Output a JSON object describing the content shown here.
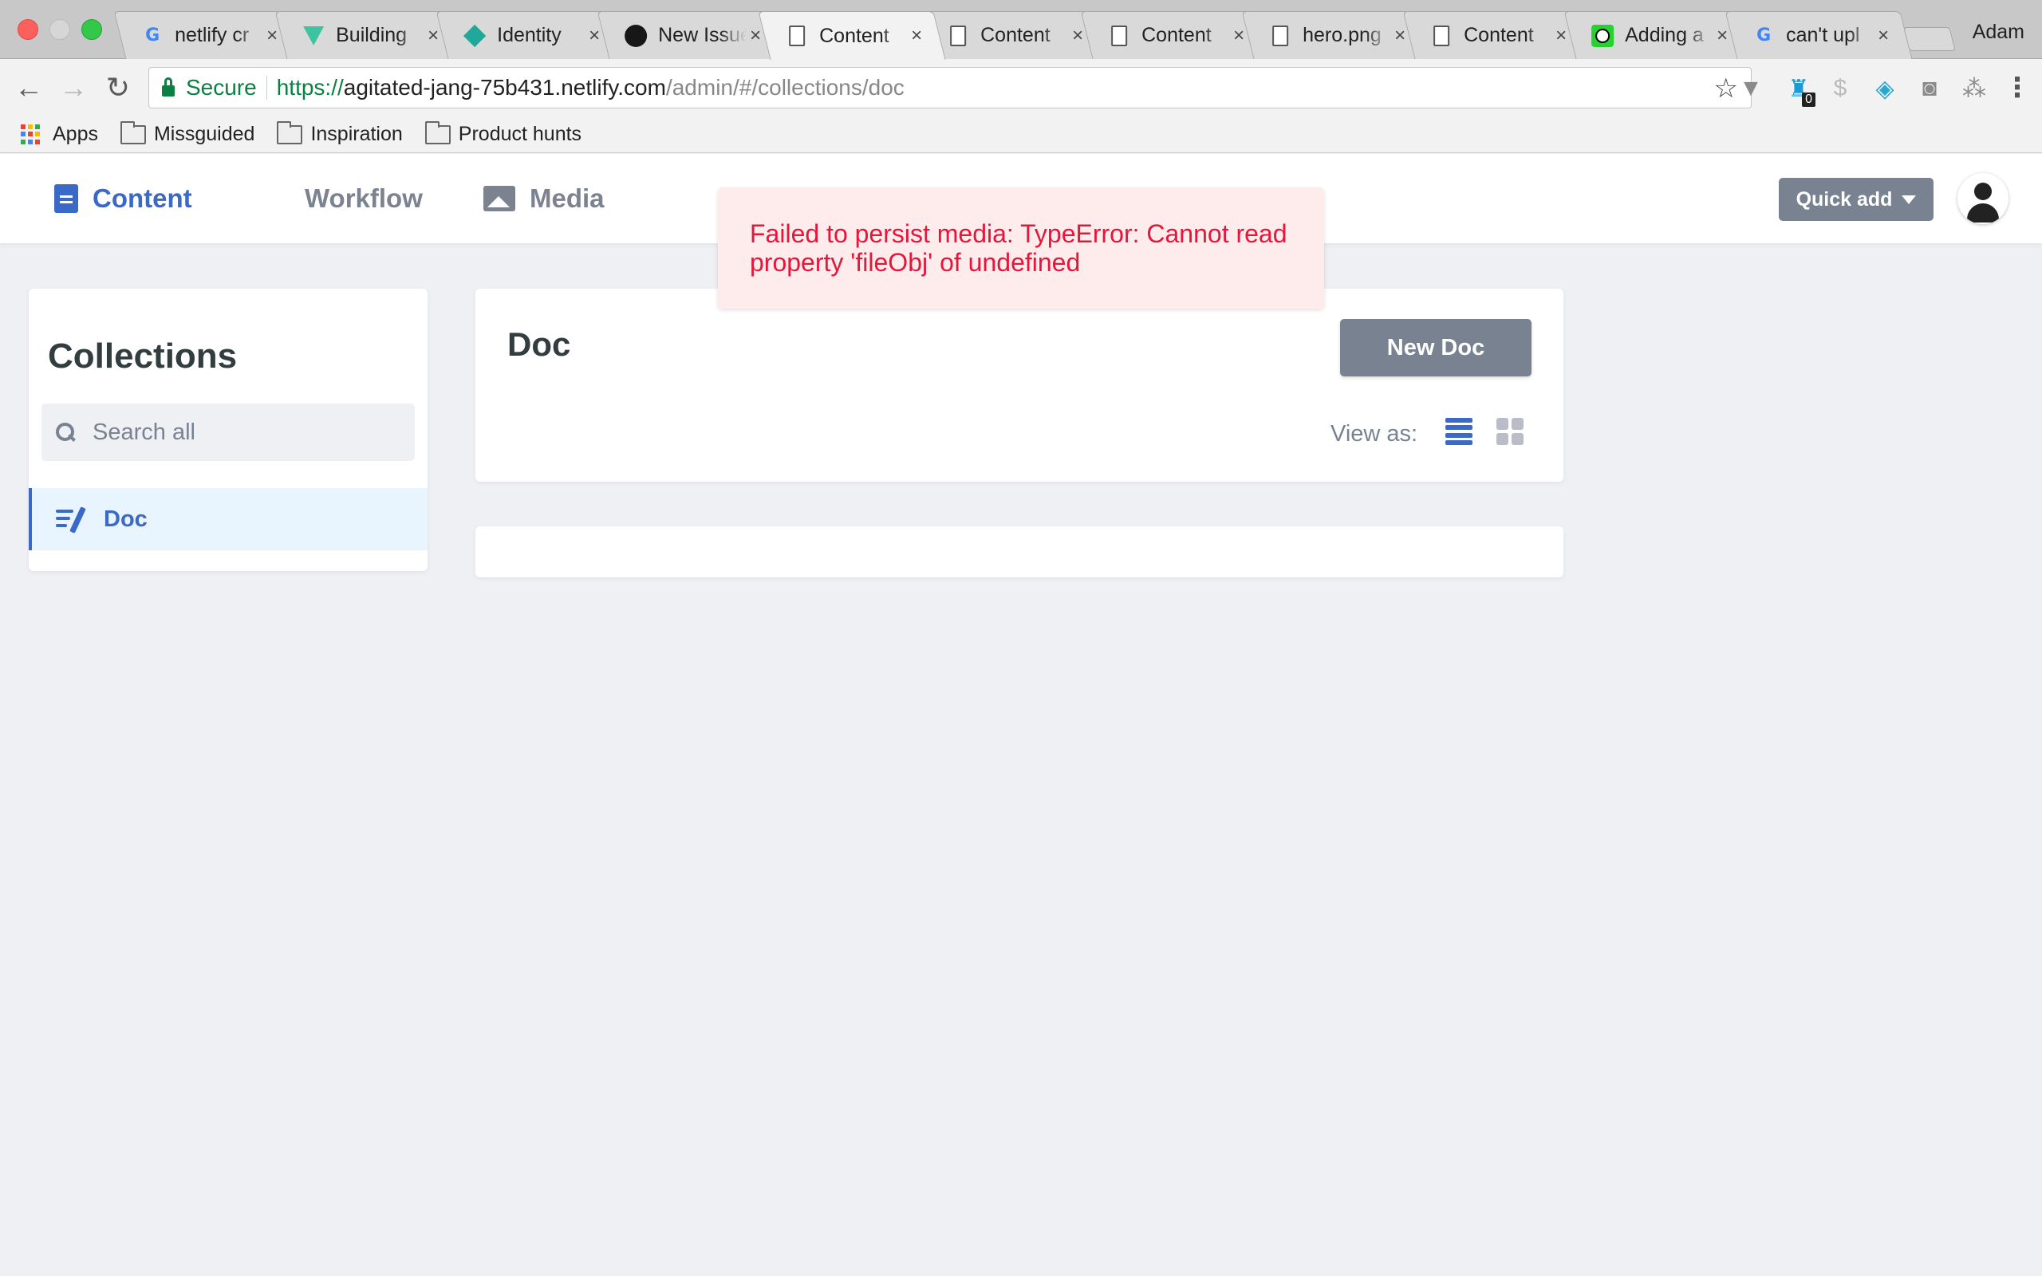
{
  "browser": {
    "tabs": [
      {
        "title": "netlify cr",
        "favicon": "google-icon",
        "active": false
      },
      {
        "title": "Building",
        "favicon": "vue-icon",
        "active": false
      },
      {
        "title": "Identity",
        "favicon": "netlify-icon",
        "active": false
      },
      {
        "title": "New Issue",
        "favicon": "github-icon",
        "active": false
      },
      {
        "title": "Content",
        "favicon": "page-icon",
        "active": true
      },
      {
        "title": "Content",
        "favicon": "page-icon",
        "active": false
      },
      {
        "title": "Content",
        "favicon": "page-icon",
        "active": false
      },
      {
        "title": "hero.png",
        "favicon": "page-icon",
        "active": false
      },
      {
        "title": "Content",
        "favicon": "page-icon",
        "active": false
      },
      {
        "title": "Adding a",
        "favicon": "clock-icon",
        "active": false
      },
      {
        "title": "can't upl",
        "favicon": "google-icon",
        "active": false
      }
    ],
    "profile_name": "Adam",
    "secure_label": "Secure",
    "url": {
      "scheme": "https://",
      "host": "agitated-jang-75b431.netlify.com",
      "path": "/admin/#/collections/doc"
    },
    "extension_badge": "0",
    "bookmarks": [
      {
        "label": "Apps",
        "icon": "apps-icon"
      },
      {
        "label": "Missguided",
        "icon": "folder-icon"
      },
      {
        "label": "Inspiration",
        "icon": "folder-icon"
      },
      {
        "label": "Product hunts",
        "icon": "folder-icon"
      }
    ]
  },
  "app": {
    "nav": {
      "content": "Content",
      "workflow": "Workflow",
      "media": "Media"
    },
    "quick_add": "Quick add",
    "toast": {
      "message": "Failed to persist media: TypeError: Cannot read property 'fileObj' of undefined",
      "color": "#e8153b"
    },
    "sidebar": {
      "title": "Collections",
      "search_placeholder": "Search all",
      "items": [
        {
          "label": "Doc"
        }
      ]
    },
    "main": {
      "title": "Doc",
      "new_button": "New Doc",
      "view_as": "View as:"
    },
    "colors": {
      "accent": "#3a69c7",
      "button_gray": "#798291",
      "background": "#eff0f4"
    }
  }
}
